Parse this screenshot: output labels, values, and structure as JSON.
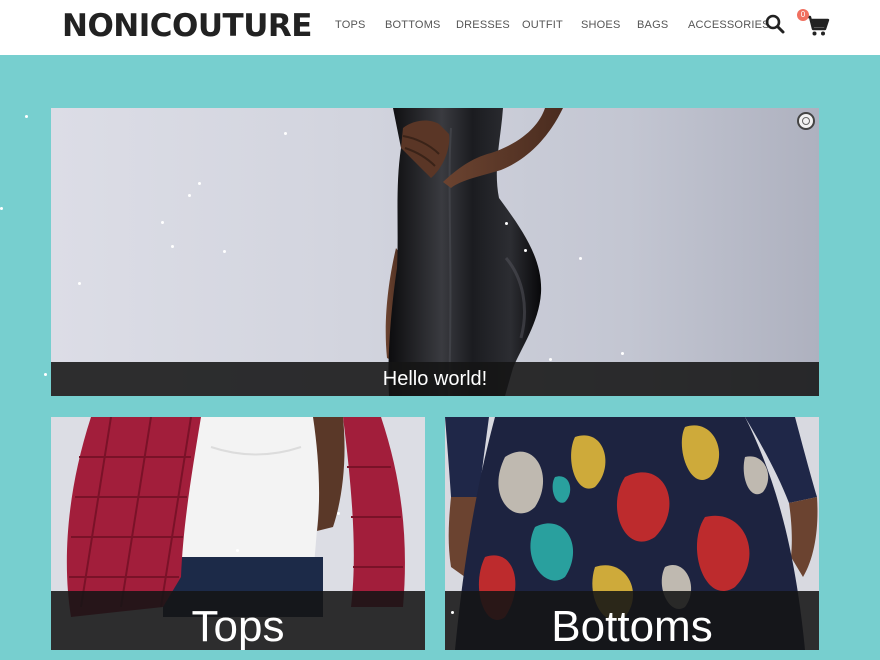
{
  "brand": {
    "logo_text": "NONICOUTURE"
  },
  "nav": {
    "items": [
      {
        "label": "TOPS"
      },
      {
        "label": "BOTTOMS"
      },
      {
        "label": "DRESSES"
      },
      {
        "label": "OUTFIT"
      },
      {
        "label": "SHOES"
      },
      {
        "label": "BAGS"
      },
      {
        "label": "ACCESSORIES"
      }
    ]
  },
  "header_icons": {
    "search": "search-icon",
    "cart": "cart-icon",
    "cart_count": "0"
  },
  "hero": {
    "caption": "Hello world!",
    "image": "model in black leather dress"
  },
  "categories": [
    {
      "label": "Tops",
      "image": "white top with red quilted jacket"
    },
    {
      "label": "Bottoms",
      "image": "floral print skirt"
    }
  ],
  "colors": {
    "page_background": "#77cfcf",
    "caption_bar": "#141414",
    "logo": "#222222",
    "badge": "#f07060"
  }
}
